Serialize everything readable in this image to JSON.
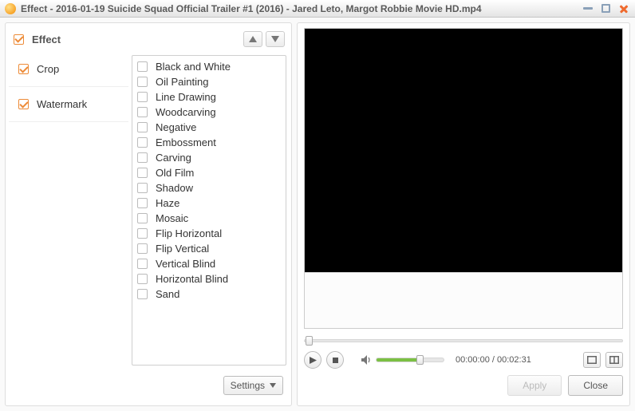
{
  "window": {
    "title": "Effect - 2016-01-19 Suicide Squad Official Trailer #1 (2016) - Jared Leto, Margot Robbie Movie HD.mp4"
  },
  "sidebar": {
    "heading": "Effect",
    "items": [
      {
        "label": "Crop",
        "checked": true
      },
      {
        "label": "Watermark",
        "checked": true
      }
    ]
  },
  "effects": [
    "Black and White",
    "Oil Painting",
    "Line Drawing",
    "Woodcarving",
    "Negative",
    "Embossment",
    "Carving",
    "Old Film",
    "Shadow",
    "Haze",
    "Mosaic",
    "Flip Horizontal",
    "Flip Vertical",
    "Vertical Blind",
    "Horizontal Blind",
    "Sand"
  ],
  "buttons": {
    "settings": "Settings",
    "apply": "Apply",
    "close": "Close"
  },
  "player": {
    "current_time": "00:00:00",
    "total_time": "00:02:31",
    "volume_percent": 62
  }
}
